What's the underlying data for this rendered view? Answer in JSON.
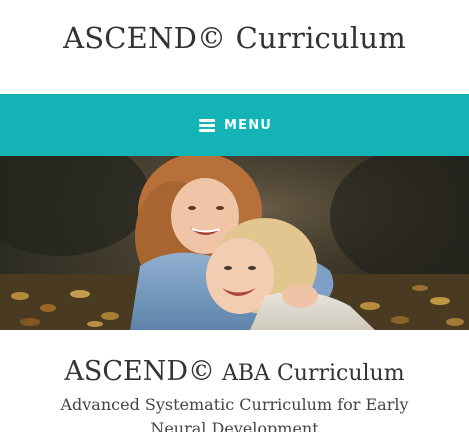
{
  "header": {
    "site_title": "ASCEND© Curriculum"
  },
  "nav": {
    "menu_label": "MENU",
    "icon": "hamburger-menu-icon",
    "background_color": "#13b3b6"
  },
  "hero": {
    "image_description_icon": "hero-photo"
  },
  "intro": {
    "heading_brand": "ASCEND©",
    "heading_rest": " ABA Curriculum",
    "tagline": "Advanced Systematic Curriculum for Early Neural Development"
  }
}
